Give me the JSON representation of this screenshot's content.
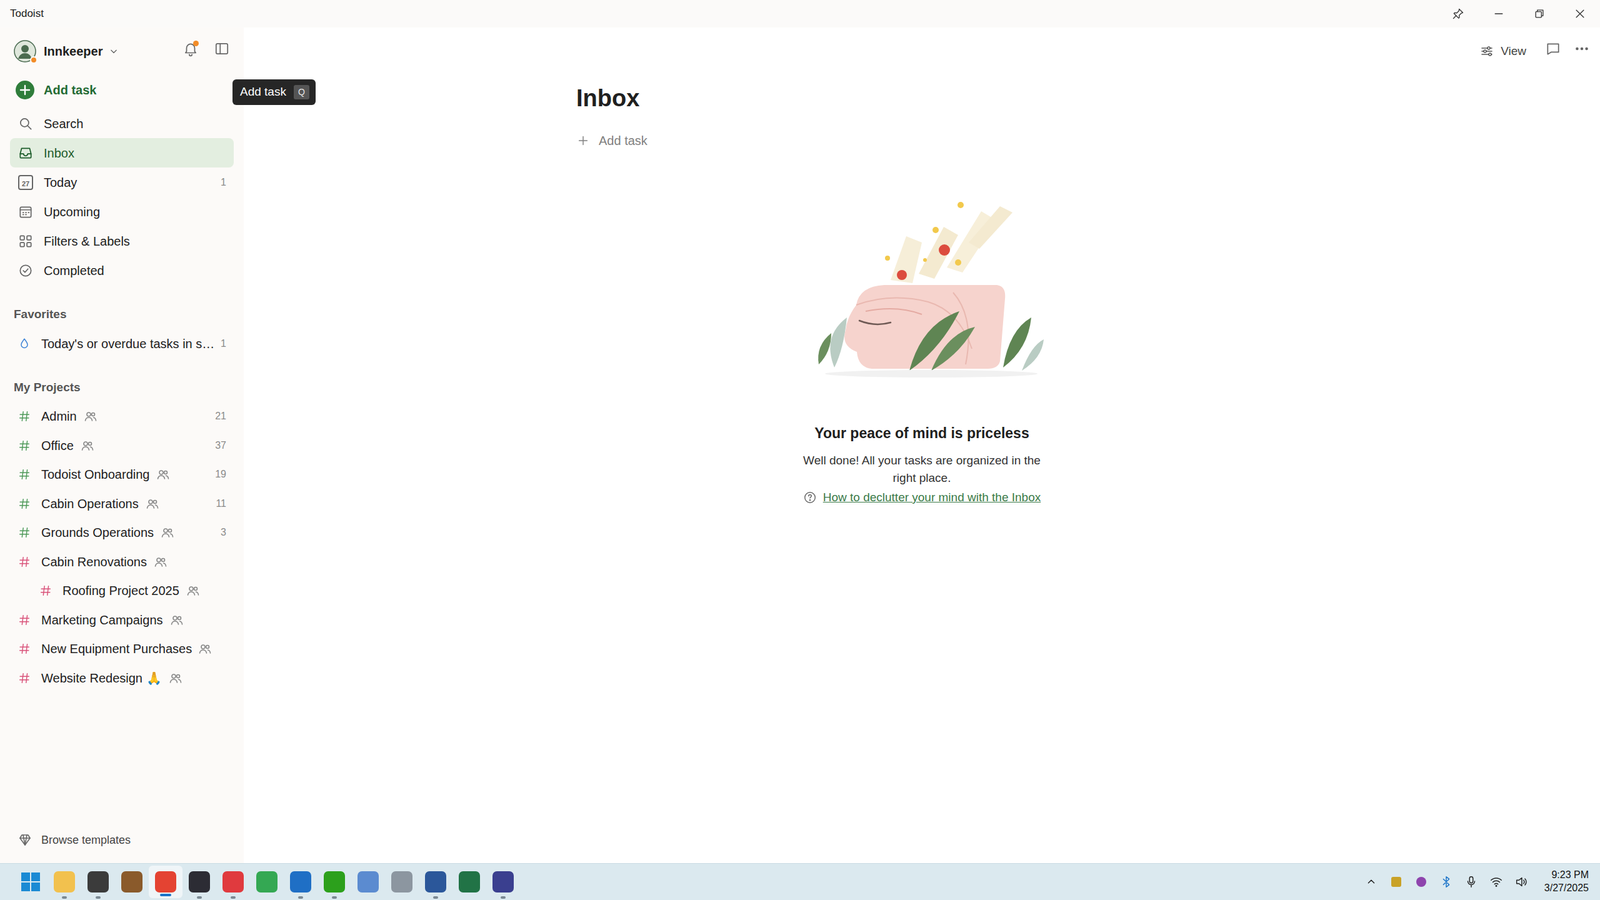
{
  "window": {
    "title": "Todoist"
  },
  "user": {
    "name": "Innkeeper",
    "status_dot": true
  },
  "notifications": {
    "unread": true
  },
  "sidebar": {
    "add_task": "Add task",
    "nav": [
      {
        "label": "Search",
        "kind": "search",
        "selected": false
      },
      {
        "label": "Inbox",
        "kind": "inbox",
        "selected": true
      },
      {
        "label": "Today",
        "kind": "today",
        "icon_text": "27",
        "count": "1",
        "selected": false
      },
      {
        "label": "Upcoming",
        "kind": "upcoming",
        "selected": false
      },
      {
        "label": "Filters & Labels",
        "kind": "filters",
        "selected": false
      },
      {
        "label": "Completed",
        "kind": "completed",
        "selected": false
      }
    ],
    "browse_templates": "Browse templates"
  },
  "tooltip": {
    "label": "Add task",
    "shortcut": "Q"
  },
  "favorites": {
    "title": "Favorites",
    "items": [
      {
        "label": "Today's or overdue tasks in s…",
        "count": "1",
        "color": "#3b82d6"
      }
    ]
  },
  "projects": {
    "title": "My Projects",
    "items": [
      {
        "label": "Admin",
        "count": "21",
        "color": "#4e9a5a",
        "shared": true,
        "nested": false
      },
      {
        "label": "Office",
        "count": "37",
        "color": "#4e9a5a",
        "shared": true,
        "nested": false
      },
      {
        "label": "Todoist Onboarding",
        "count": "19",
        "color": "#4e9a5a",
        "shared": true,
        "nested": false
      },
      {
        "label": "Cabin Operations",
        "count": "11",
        "color": "#4e9a5a",
        "shared": true,
        "nested": false
      },
      {
        "label": "Grounds Operations",
        "count": "3",
        "color": "#4e9a5a",
        "shared": true,
        "nested": false
      },
      {
        "label": "Cabin Renovations",
        "count": "",
        "color": "#d9537a",
        "shared": true,
        "nested": false
      },
      {
        "label": "Roofing Project 2025",
        "count": "",
        "color": "#d9537a",
        "shared": true,
        "nested": true
      },
      {
        "label": "Marketing Campaigns",
        "count": "",
        "color": "#d9537a",
        "shared": true,
        "nested": false
      },
      {
        "label": "New Equipment Purchases",
        "count": "",
        "color": "#d9537a",
        "shared": true,
        "nested": false
      },
      {
        "label": "Website Redesign 🙏",
        "count": "",
        "color": "#d9537a",
        "shared": true,
        "nested": false
      }
    ]
  },
  "main": {
    "title": "Inbox",
    "add_task": "Add task",
    "view": "View",
    "empty": {
      "title": "Your peace of mind is priceless",
      "text": "Well done! All your tasks are organized in the right place.",
      "link": "How to declutter your mind with the Inbox"
    }
  },
  "taskbar": {
    "apps": [
      {
        "color": "#f2c14e",
        "running": true,
        "active": false
      },
      {
        "color": "#3b3b3b",
        "running": true,
        "active": false
      },
      {
        "color": "#8a5a2b",
        "running": false,
        "active": false
      },
      {
        "color": "#e44332",
        "running": true,
        "active": true
      },
      {
        "color": "#2c2c34",
        "running": true,
        "active": false
      },
      {
        "color": "#e03a3e",
        "running": true,
        "active": false
      },
      {
        "color": "#34a853",
        "running": false,
        "active": false
      },
      {
        "color": "#1f6fc5",
        "running": true,
        "active": false
      },
      {
        "color": "#2ca01c",
        "running": true,
        "active": false
      },
      {
        "color": "#5b8bd0",
        "running": false,
        "active": false
      },
      {
        "color": "#8c96a0",
        "running": false,
        "active": false
      },
      {
        "color": "#2b579a",
        "running": true,
        "active": false
      },
      {
        "color": "#217346",
        "running": false,
        "active": false
      },
      {
        "color": "#3a3f8f",
        "running": true,
        "active": false
      }
    ],
    "clock": {
      "time": "9:23 PM",
      "date": "3/27/2025"
    }
  }
}
